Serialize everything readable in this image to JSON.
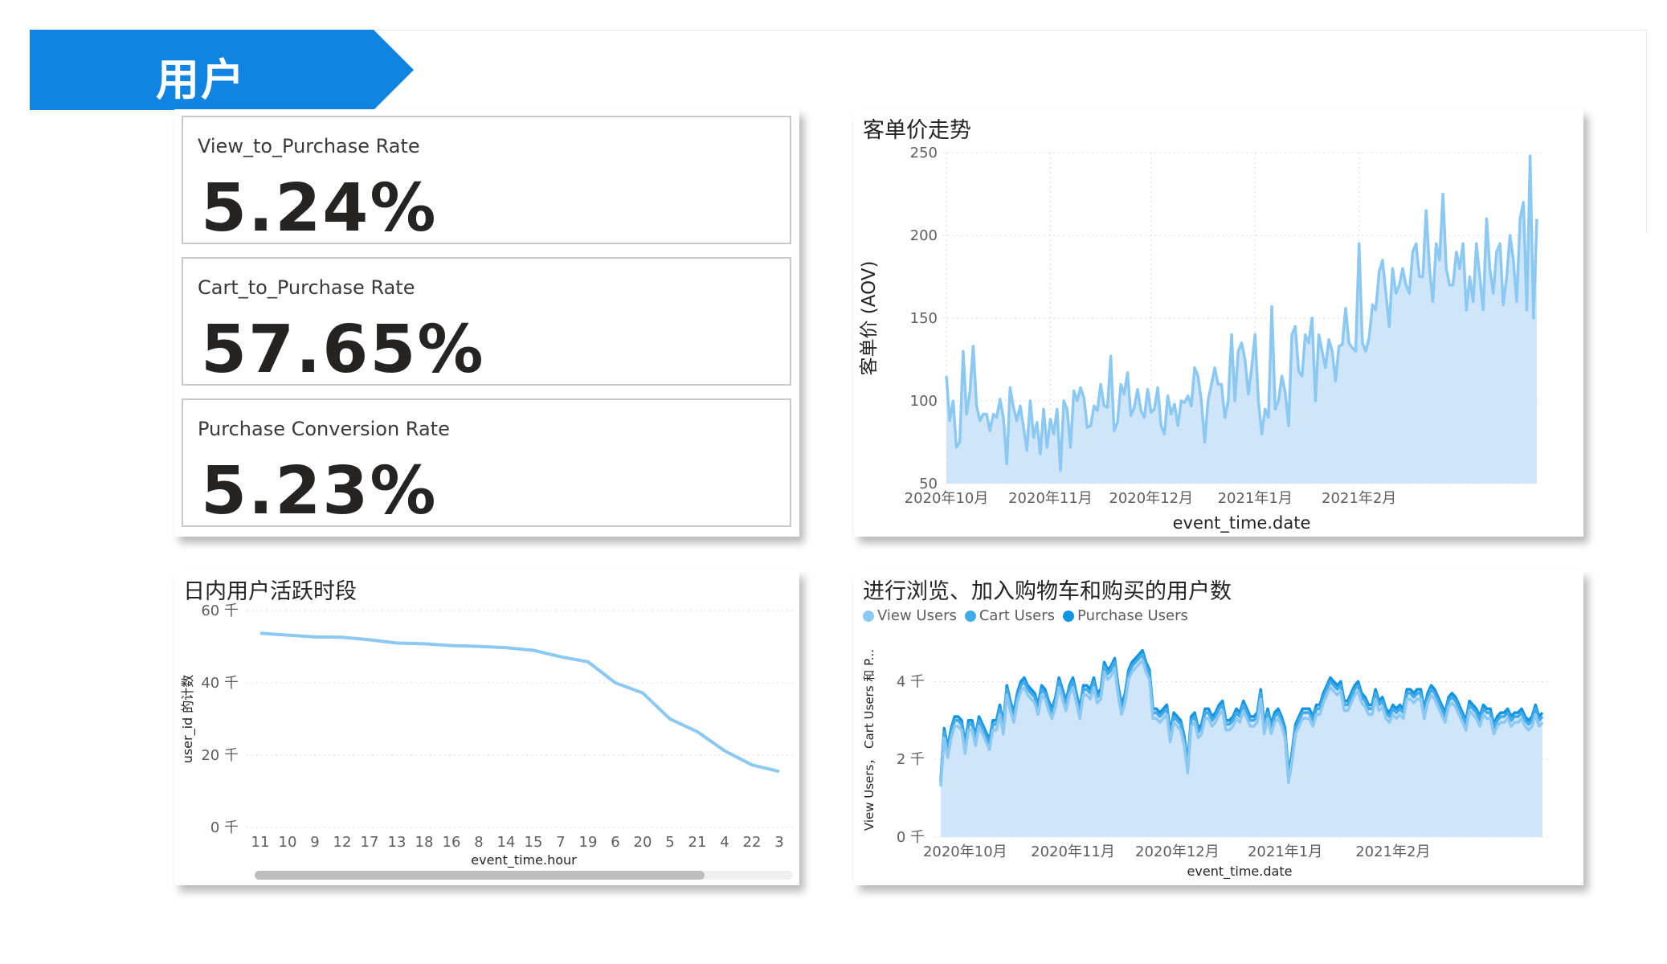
{
  "section": {
    "title": "用户"
  },
  "kpis": [
    {
      "label": "View_to_Purchase Rate",
      "value": "5.24%"
    },
    {
      "label": "Cart_to_Purchase Rate",
      "value": "57.65%"
    },
    {
      "label": "Purchase Conversion Rate",
      "value": "5.23%"
    }
  ],
  "colors": {
    "header_blue": "#1184e1",
    "light_blue": "#8bc8f2",
    "area_fill": "#cfe6fa",
    "series_view": "#8bc8f2",
    "series_cart": "#42aae9",
    "series_purchase": "#1295e0"
  },
  "aov": {
    "title": "客单价走势",
    "ylabel": "客单价 (AOV)",
    "xlabel": "event_time.date"
  },
  "hourly": {
    "title": "日内用户活跃时段",
    "ylabel": "user_id 的计数",
    "xlabel": "event_time.hour"
  },
  "funnel": {
    "title": "进行浏览、加入购物车和购买的用户数",
    "ylabel": "View Users， Cart Users 和 P...",
    "xlabel": "event_time.date",
    "legend": [
      "View Users",
      "Cart Users",
      "Purchase Users"
    ]
  },
  "chart_data": [
    {
      "id": "aov",
      "type": "area",
      "title": "客单价走势",
      "xlabel": "event_time.date",
      "ylabel": "客单价 (AOV)",
      "x_ticks": [
        "2020年10月",
        "2020年11月",
        "2020年12月",
        "2021年1月",
        "2021年2月"
      ],
      "y_ticks": [
        50,
        100,
        150,
        200,
        250
      ],
      "ylim": [
        50,
        250
      ],
      "x_start": "2020-10-01",
      "values": [
        115,
        88,
        100,
        72,
        75,
        130,
        92,
        105,
        133,
        97,
        88,
        92,
        92,
        82,
        92,
        90,
        101,
        90,
        62,
        108,
        96,
        88,
        97,
        84,
        70,
        100,
        78,
        87,
        68,
        95,
        72,
        89,
        80,
        95,
        58,
        100,
        95,
        72,
        106,
        100,
        108,
        102,
        84,
        85,
        97,
        94,
        110,
        97,
        96,
        127,
        82,
        87,
        110,
        104,
        117,
        91,
        96,
        107,
        94,
        90,
        107,
        93,
        95,
        108,
        85,
        80,
        103,
        92,
        98,
        85,
        100,
        99,
        103,
        97,
        120,
        115,
        100,
        75,
        100,
        110,
        120,
        110,
        110,
        90,
        100,
        140,
        100,
        130,
        135,
        125,
        104,
        120,
        140,
        100,
        80,
        95,
        90,
        157,
        95,
        100,
        115,
        105,
        85,
        140,
        145,
        118,
        115,
        140,
        135,
        150,
        100,
        140,
        130,
        120,
        137,
        130,
        112,
        133,
        134,
        156,
        135,
        132,
        130,
        195,
        135,
        130,
        138,
        158,
        155,
        178,
        185,
        165,
        145,
        180,
        165,
        170,
        180,
        170,
        165,
        190,
        195,
        175,
        175,
        215,
        180,
        160,
        195,
        185,
        225,
        180,
        170,
        170,
        190,
        180,
        195,
        155,
        175,
        160,
        195,
        175,
        155,
        210,
        180,
        165,
        190,
        195,
        158,
        175,
        200,
        185,
        160,
        210,
        220,
        155,
        248,
        150,
        210
      ]
    },
    {
      "id": "hourly",
      "type": "line",
      "title": "日内用户活跃时段",
      "xlabel": "event_time.hour",
      "ylabel": "user_id 的计数",
      "categories": [
        "11",
        "10",
        "9",
        "12",
        "17",
        "13",
        "18",
        "16",
        "8",
        "14",
        "15",
        "7",
        "19",
        "6",
        "20",
        "5",
        "21",
        "4",
        "22",
        "3"
      ],
      "values": [
        53700,
        53200,
        52700,
        52600,
        51900,
        51000,
        50800,
        50300,
        50100,
        49700,
        49000,
        47200,
        45800,
        40000,
        37200,
        30000,
        26500,
        21200,
        17300,
        15500
      ],
      "y_ticks": [
        "0 千",
        "20 千",
        "40 千",
        "60 千"
      ],
      "ylim": [
        0,
        60000
      ]
    },
    {
      "id": "funnel",
      "type": "area",
      "title": "进行浏览、加入购物车和购买的用户数",
      "xlabel": "event_time.date",
      "ylabel": "View Users， Cart Users 和 P...",
      "x_ticks": [
        "2020年10月",
        "2020年11月",
        "2020年12月",
        "2021年1月",
        "2021年2月"
      ],
      "y_ticks": [
        "0 千",
        "2 千",
        "4 千"
      ],
      "ylim": [
        0,
        5000
      ],
      "x_start": "2020-09-24",
      "series": [
        {
          "name": "Purchase Users",
          "values": [
            1450,
            2800,
            2300,
            2800,
            3100,
            3100,
            3000,
            2400,
            3000,
            3000,
            2600,
            3100,
            2900,
            2700,
            2500,
            3000,
            3000,
            3400,
            2900,
            3900,
            3500,
            3200,
            3700,
            4000,
            4100,
            3900,
            3800,
            3700,
            3400,
            3900,
            3800,
            3500,
            3300,
            3600,
            4100,
            3800,
            3500,
            3900,
            4100,
            3700,
            3300,
            3900,
            3900,
            3800,
            4100,
            3700,
            3800,
            4500,
            4300,
            4400,
            4600,
            3900,
            3400,
            3700,
            4300,
            4500,
            4600,
            4700,
            4800,
            4500,
            4300,
            3300,
            3300,
            3200,
            3300,
            3400,
            2700,
            3200,
            3100,
            3000,
            2600,
            1900,
            3100,
            3200,
            2800,
            2900,
            3300,
            3300,
            3100,
            3200,
            3400,
            3500,
            3000,
            3000,
            3100,
            3300,
            3200,
            3500,
            3300,
            3100,
            3100,
            3200,
            3800,
            2900,
            3300,
            2900,
            3200,
            3300,
            3100,
            2800,
            1600,
            2200,
            2900,
            3100,
            3300,
            3300,
            3300,
            3100,
            3400,
            3400,
            3700,
            3900,
            4100,
            4000,
            3900,
            4000,
            3500,
            3500,
            3700,
            3900,
            4000,
            3700,
            3600,
            3400,
            3400,
            3800,
            3500,
            3600,
            3300,
            3200,
            3400,
            3300,
            3400,
            3300,
            3800,
            3800,
            3700,
            3800,
            3800,
            3300,
            3700,
            3900,
            3800,
            3600,
            3400,
            3200,
            3600,
            3700,
            3600,
            3400,
            3200,
            3000,
            3500,
            3400,
            3300,
            3100,
            3400,
            3300,
            3300,
            2900,
            3100,
            3200,
            3200,
            3300,
            3100,
            3200,
            3200,
            3300,
            3100,
            3000,
            3100,
            3400,
            3100,
            3200
          ]
        },
        {
          "name": "Cart Users",
          "values": [
            1400,
            2700,
            2200,
            2700,
            3000,
            3000,
            2900,
            2300,
            2900,
            2900,
            2500,
            3000,
            2800,
            2600,
            2400,
            2900,
            2900,
            3300,
            2800,
            3800,
            3400,
            3100,
            3600,
            3900,
            4000,
            3800,
            3700,
            3600,
            3300,
            3800,
            3700,
            3400,
            3200,
            3500,
            4000,
            3700,
            3400,
            3800,
            4000,
            3600,
            3200,
            3800,
            3800,
            3700,
            4000,
            3600,
            3700,
            4400,
            4200,
            4300,
            4500,
            3800,
            3300,
            3600,
            4200,
            4400,
            4500,
            4600,
            4700,
            4400,
            4200,
            3200,
            3200,
            3100,
            3200,
            3300,
            2600,
            3100,
            3000,
            2900,
            2500,
            1800,
            3000,
            3100,
            2700,
            2800,
            3200,
            3200,
            3000,
            3100,
            3300,
            3400,
            2900,
            2900,
            3000,
            3200,
            3100,
            3400,
            3200,
            3000,
            3000,
            3100,
            3700,
            2800,
            3200,
            2800,
            3100,
            3200,
            3000,
            2700,
            1500,
            2100,
            2800,
            3000,
            3200,
            3200,
            3200,
            3000,
            3300,
            3300,
            3600,
            3800,
            4000,
            3900,
            3800,
            3900,
            3400,
            3400,
            3600,
            3800,
            3900,
            3600,
            3500,
            3300,
            3300,
            3700,
            3400,
            3500,
            3200,
            3100,
            3300,
            3200,
            3300,
            3200,
            3700,
            3700,
            3600,
            3700,
            3700,
            3200,
            3600,
            3800,
            3700,
            3500,
            3300,
            3100,
            3500,
            3600,
            3500,
            3300,
            3100,
            2900,
            3400,
            3300,
            3200,
            3000,
            3300,
            3200,
            3200,
            2800,
            3000,
            3100,
            3100,
            3200,
            3000,
            3100,
            3100,
            3200,
            3000,
            2900,
            3000,
            3300,
            3000,
            3100
          ]
        },
        {
          "name": "View Users",
          "values": [
            1300,
            2550,
            2050,
            2550,
            2850,
            2850,
            2750,
            2150,
            2750,
            2750,
            2350,
            2850,
            2650,
            2450,
            2250,
            2750,
            2750,
            3150,
            2650,
            3650,
            3250,
            2950,
            3450,
            3750,
            3850,
            3650,
            3550,
            3450,
            3150,
            3650,
            3550,
            3250,
            3050,
            3350,
            3850,
            3550,
            3250,
            3650,
            3850,
            3450,
            3050,
            3650,
            3650,
            3550,
            3850,
            3450,
            3550,
            4250,
            4050,
            4150,
            4350,
            3650,
            3150,
            3450,
            4050,
            4250,
            4350,
            4450,
            4550,
            4250,
            4050,
            3050,
            3050,
            2950,
            3050,
            3150,
            2450,
            2950,
            2850,
            2750,
            2350,
            1650,
            2850,
            2950,
            2550,
            2650,
            3050,
            3050,
            2850,
            2950,
            3150,
            3250,
            2750,
            2750,
            2850,
            3050,
            2950,
            3250,
            3050,
            2850,
            2850,
            2950,
            3550,
            2650,
            3050,
            2650,
            2950,
            3050,
            2850,
            2550,
            1400,
            1950,
            2650,
            2850,
            3050,
            3050,
            3050,
            2850,
            3150,
            3150,
            3450,
            3650,
            3850,
            3750,
            3650,
            3750,
            3250,
            3250,
            3450,
            3650,
            3750,
            3450,
            3350,
            3150,
            3150,
            3550,
            3250,
            3350,
            3050,
            2950,
            3150,
            3050,
            3150,
            3050,
            3550,
            3550,
            3450,
            3550,
            3550,
            3050,
            3450,
            3650,
            3550,
            3350,
            3150,
            2950,
            3350,
            3450,
            3350,
            3150,
            2950,
            2750,
            3250,
            3150,
            3050,
            2850,
            3150,
            3050,
            3050,
            2650,
            2850,
            2950,
            2950,
            3050,
            2850,
            2950,
            2950,
            3050,
            2850,
            2750,
            2850,
            3150,
            2850,
            2950
          ]
        }
      ]
    }
  ]
}
